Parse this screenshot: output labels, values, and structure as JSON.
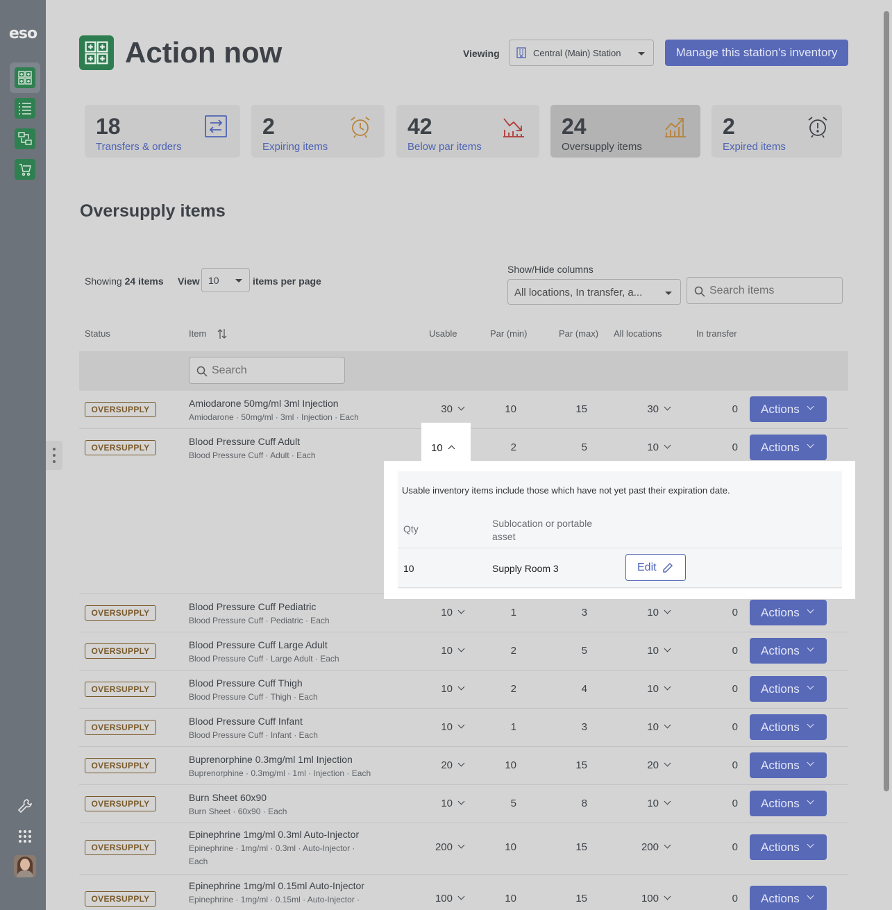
{
  "app": {
    "logo": "eso"
  },
  "sidebar": {
    "items": [
      {
        "icon": "first-aid-grid-icon",
        "active": true
      },
      {
        "icon": "list-icon"
      },
      {
        "icon": "transfer-boxes-icon"
      },
      {
        "icon": "cart-icon"
      }
    ],
    "bottom": [
      {
        "icon": "wrench-icon"
      },
      {
        "icon": "apps-grid-icon"
      },
      {
        "icon": "user-avatar"
      }
    ]
  },
  "header": {
    "title": "Action now",
    "viewing_label": "Viewing",
    "station": "Central (Main) Station",
    "manage_label": "Manage this station's inventory"
  },
  "cards": [
    {
      "count": "18",
      "label": "Transfers & orders",
      "icon": "transfer-arrows-icon",
      "color": "#4e63b5"
    },
    {
      "count": "2",
      "label": "Expiring items",
      "icon": "alarm-clock-icon",
      "color": "#b8823a"
    },
    {
      "count": "42",
      "label": "Below par items",
      "icon": "down-trend-chart-icon",
      "color": "#b03a3a"
    },
    {
      "count": "24",
      "label": "Oversupply items",
      "icon": "up-trend-chart-icon",
      "color": "#b8823a",
      "active": true
    },
    {
      "count": "2",
      "label": "Expired items",
      "icon": "alarm-clock-alert-icon",
      "color": "#3d4248"
    }
  ],
  "section_title": "Oversupply items",
  "controls": {
    "showing_prefix": "Showing",
    "showing_count": "24 items",
    "view_label": "View",
    "per_page": "10",
    "per_page_suffix": "items per page",
    "show_hide_label": "Show/Hide columns",
    "columns_value": "All locations, In transfer, a...",
    "search_placeholder": "Search items"
  },
  "table": {
    "headers": {
      "status": "Status",
      "item": "Item",
      "usable": "Usable",
      "par_min": "Par (min)",
      "par_max": "Par (max)",
      "all_locations": "All locations",
      "in_transfer": "In transfer"
    },
    "filter_placeholder": "Search",
    "status_label": "OVERSUPPLY",
    "actions_label": "Actions",
    "rows": [
      {
        "name": "Amiodarone 50mg/ml 3ml Injection",
        "sub": "Amiodarone · 50mg/ml · 3ml · Injection · Each",
        "usable": "30",
        "par_min": "10",
        "par_max": "15",
        "all": "30",
        "transfer": "0"
      },
      {
        "name": "Blood Pressure Cuff Adult",
        "sub": "Blood Pressure Cuff · Adult · Each",
        "usable": "10",
        "par_min": "2",
        "par_max": "5",
        "all": "10",
        "transfer": "0",
        "expanded": true
      },
      {
        "name": "Blood Pressure Cuff Pediatric",
        "sub": "Blood Pressure Cuff · Pediatric · Each",
        "usable": "10",
        "par_min": "1",
        "par_max": "3",
        "all": "10",
        "transfer": "0"
      },
      {
        "name": "Blood Pressure Cuff Large Adult",
        "sub": "Blood Pressure Cuff · Large Adult · Each",
        "usable": "10",
        "par_min": "2",
        "par_max": "5",
        "all": "10",
        "transfer": "0"
      },
      {
        "name": "Blood Pressure Cuff Thigh",
        "sub": "Blood Pressure Cuff · Thigh · Each",
        "usable": "10",
        "par_min": "2",
        "par_max": "4",
        "all": "10",
        "transfer": "0"
      },
      {
        "name": "Blood Pressure Cuff Infant",
        "sub": "Blood Pressure Cuff · Infant · Each",
        "usable": "10",
        "par_min": "1",
        "par_max": "3",
        "all": "10",
        "transfer": "0"
      },
      {
        "name": "Buprenorphine 0.3mg/ml 1ml Injection",
        "sub": "Buprenorphine · 0.3mg/ml · 1ml · Injection · Each",
        "usable": "20",
        "par_min": "10",
        "par_max": "15",
        "all": "20",
        "transfer": "0"
      },
      {
        "name": "Burn Sheet 60x90",
        "sub": "Burn Sheet · 60x90 · Each",
        "usable": "10",
        "par_min": "5",
        "par_max": "8",
        "all": "10",
        "transfer": "0"
      },
      {
        "name": "Epinephrine 1mg/ml 0.3ml Auto-Injector",
        "sub": "Epinephrine · 1mg/ml · 0.3ml · Auto-Injector ·",
        "sub2": "Each",
        "usable": "200",
        "par_min": "10",
        "par_max": "15",
        "all": "200",
        "transfer": "0"
      },
      {
        "name": "Epinephrine 1mg/ml 0.15ml Auto-Injector",
        "sub": "Epinephrine · 1mg/ml · 0.15ml · Auto-Injector ·",
        "usable": "100",
        "par_min": "10",
        "par_max": "15",
        "all": "100",
        "transfer": "0"
      }
    ]
  },
  "popover": {
    "usable_value": "10",
    "note": "Usable inventory items include those which have not yet past their expiration date.",
    "qty_header": "Qty",
    "location_header": "Sublocation or portable asset",
    "qty": "10",
    "location": "Supply Room 3",
    "edit_label": "Edit"
  }
}
